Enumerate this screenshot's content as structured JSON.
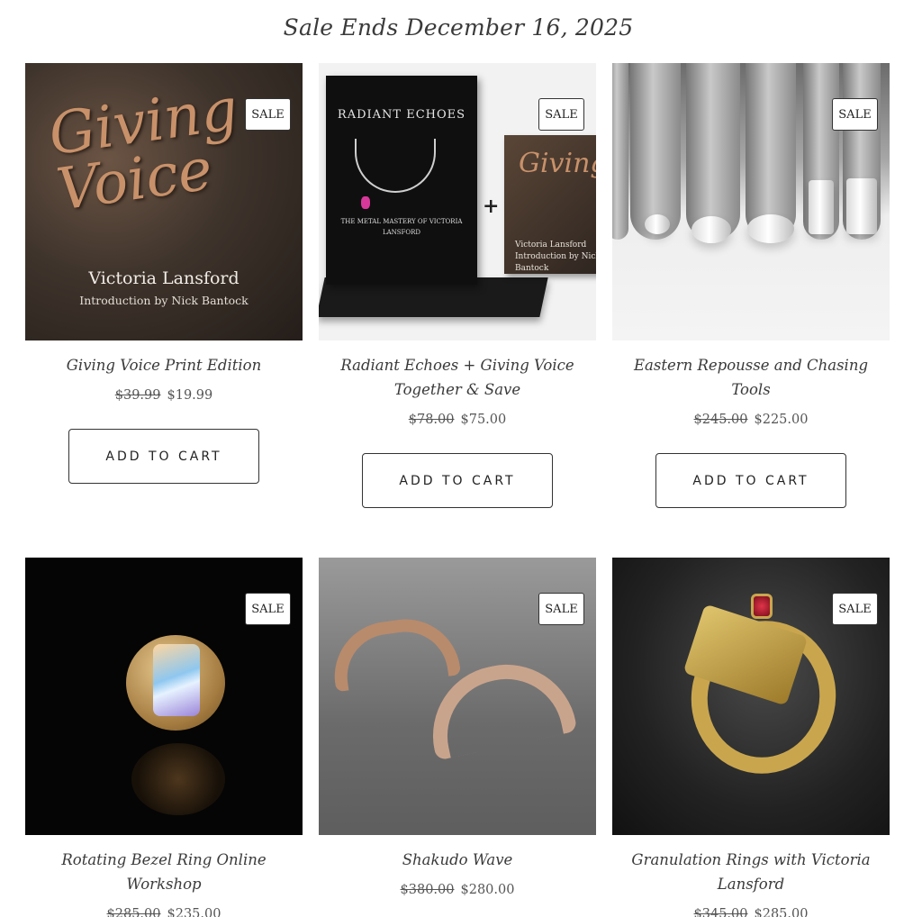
{
  "header": {
    "title": "Sale Ends December 16, 2025"
  },
  "badge_label": "SALE",
  "button_label": "ADD TO CART",
  "products": [
    {
      "name": "Giving Voice Print Edition",
      "old_price": "$39.99",
      "price": "$19.99",
      "image": {
        "title": "Giving Voice",
        "author": "Victoria Lansford",
        "intro": "Introduction by Nick Bantock"
      }
    },
    {
      "name": "Radiant Echoes + Giving Voice Together & Save",
      "old_price": "$78.00",
      "price": "$75.00",
      "image": {
        "bookA_title": "RADIANT ECHOES",
        "bookA_sub": "THE METAL MASTERY OF VICTORIA LANSFORD",
        "plus": "+",
        "bookC_title": "Giving",
        "bookC_author": "Victoria Lansford",
        "bookC_intro": "Introduction by Nick Bantock"
      }
    },
    {
      "name": "Eastern Repousse and Chasing Tools",
      "old_price": "$245.00",
      "price": "$225.00"
    },
    {
      "name": "Rotating Bezel Ring Online Workshop",
      "old_price": "$285.00",
      "price": "$235.00"
    },
    {
      "name": "Shakudo Wave",
      "old_price": "$380.00",
      "price": "$280.00"
    },
    {
      "name": "Granulation Rings with Victoria Lansford",
      "old_price": "$345.00",
      "price": "$285.00"
    }
  ]
}
